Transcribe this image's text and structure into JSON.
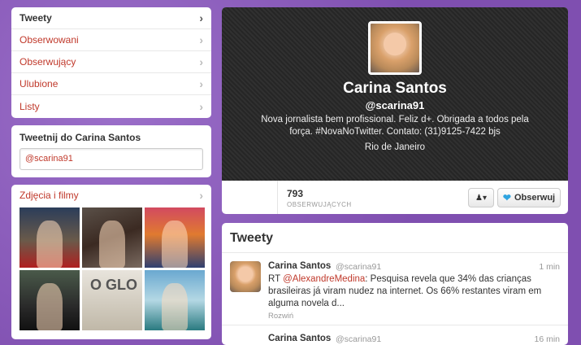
{
  "nav": {
    "items": [
      {
        "label": "Tweety",
        "active": true
      },
      {
        "label": "Obserwowani",
        "active": false
      },
      {
        "label": "Obserwujący",
        "active": false
      },
      {
        "label": "Ulubione",
        "active": false
      },
      {
        "label": "Listy",
        "active": false
      }
    ]
  },
  "tweet_to": {
    "title": "Tweetnij do Carina Santos",
    "value": "@scarina91"
  },
  "media": {
    "title": "Zdjęcia i filmy",
    "thumb_logo": "O GLO"
  },
  "profile": {
    "name": "Carina Santos",
    "handle": "@scarina91",
    "bio": "Nova jornalista bem profissional. Feliz d+. Obrigada a todos pela força. #NovaNoTwitter. Contato: (31)9125-7422 bjs",
    "location": "Rio de Janeiro",
    "followers_count": "793",
    "followers_label": "OBSERWUJĄCYCH",
    "follow_button": "Obserwuj",
    "user_dropdown": "▾"
  },
  "tweets": {
    "header": "Tweety",
    "items": [
      {
        "name": "Carina Santos",
        "handle": "@scarina91",
        "time": "1 min",
        "prefix": "RT ",
        "mention": "@AlexandreMedina",
        "text": ": Pesquisa revela que 34% das crianças brasileiras já viram nudez na internet. Os 66% restantes viram em alguma novela d...",
        "expand": "Rozwiń"
      },
      {
        "name": "Carina Santos",
        "handle": "@scarina91",
        "time": "16 min"
      }
    ]
  },
  "colors": {
    "background": "#8a5cb8",
    "link": "#c0392b",
    "cover": "#2d2d2d"
  }
}
